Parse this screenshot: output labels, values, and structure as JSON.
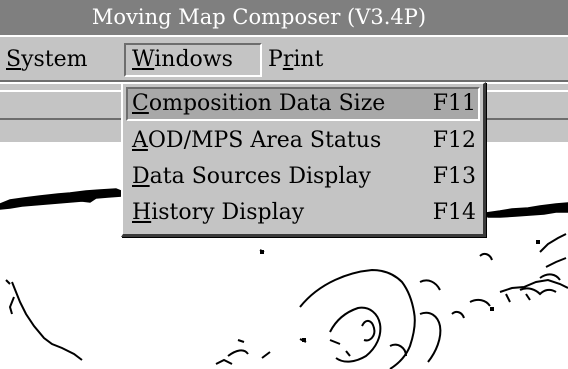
{
  "window": {
    "title": "Moving Map Composer  (V3.4P)"
  },
  "menubar": {
    "items": [
      {
        "label": "System",
        "mnemonic_index": 0
      },
      {
        "label": "Windows",
        "mnemonic_index": 0
      },
      {
        "label": "Print",
        "mnemonic_index": 1
      }
    ]
  },
  "windows_menu": {
    "items": [
      {
        "label": "Composition Data Size",
        "shortcut": "F11",
        "mnemonic_index": 0,
        "highlighted": true
      },
      {
        "label": "AOD/MPS Area Status",
        "shortcut": "F12",
        "mnemonic_index": 0,
        "highlighted": false
      },
      {
        "label": "Data Sources Display",
        "shortcut": "F13",
        "mnemonic_index": 0,
        "highlighted": false
      },
      {
        "label": "History Display",
        "shortcut": "F14",
        "mnemonic_index": 0,
        "highlighted": false
      }
    ]
  },
  "colors": {
    "titlebar_bg": "#7f7f7f",
    "menu_bg": "#c4c4c4",
    "highlight_bg": "#a8a8a8",
    "map_bg": "#ffffff",
    "coastline": "#000000"
  }
}
